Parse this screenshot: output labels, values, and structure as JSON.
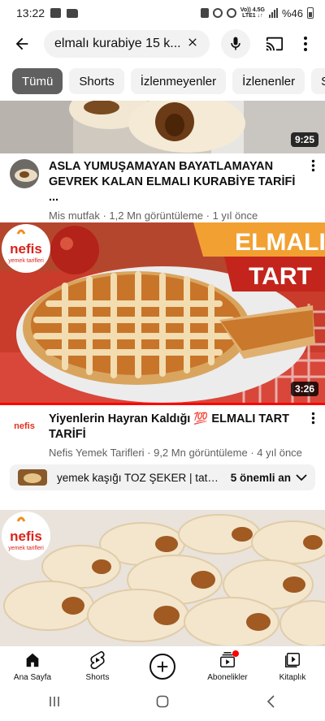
{
  "status_bar": {
    "time": "13:22",
    "network_top": "Vo)) 4.5G",
    "network_bottom": "LTE1 ↓↑",
    "battery": "%46"
  },
  "search": {
    "query": "elmalı kurabiye 15 k...",
    "back_icon": "arrow-left-icon",
    "clear_icon": "close-icon",
    "mic_icon": "microphone-icon",
    "cast_icon": "cast-icon",
    "more_icon": "more-vertical-icon"
  },
  "chips": [
    {
      "label": "Tümü",
      "active": true
    },
    {
      "label": "Shorts",
      "active": false
    },
    {
      "label": "İzlenmeyenler",
      "active": false
    },
    {
      "label": "İzlenenler",
      "active": false
    },
    {
      "label": "Si",
      "active": false
    }
  ],
  "videos": [
    {
      "duration": "9:25",
      "title": "ASLA YUMUŞAMAYAN BAYATLAMAYAN GEVREK KALAN  ELMALI KURABİYE TARİFİ ...",
      "channel": "Mis mutfak",
      "meta": "Mis mutfak · 1,2 Mn görüntüleme · 1 yıl önce"
    },
    {
      "duration": "3:26",
      "thumb_banner_1": "ELMALI",
      "thumb_banner_2": "TART",
      "thumb_logo_1": "nefis",
      "thumb_logo_2": "yemek tarifleri",
      "title": "Yiyenlerin Hayran Kaldığı 💯 ELMALI TART TARİFİ",
      "channel": "Nefis Yemek Tarifleri",
      "meta": "Nefis Yemek Tarifleri · 9,2 Mn görüntüleme · 4 yıl önce",
      "avatar_text": "nefis"
    },
    {
      "thumb_logo_1": "nefis",
      "thumb_logo_2": "yemek tarifleri"
    }
  ],
  "key_moments": {
    "text": "yemek kaşığı TOZ ŞEKER | tatlı...",
    "count": "5 önemli an"
  },
  "bottom_nav": [
    {
      "label": "Ana Sayfa",
      "icon": "home-icon"
    },
    {
      "label": "Shorts",
      "icon": "shorts-icon"
    },
    {
      "label": "",
      "icon": "create-icon"
    },
    {
      "label": "Abonelikler",
      "icon": "subscriptions-icon"
    },
    {
      "label": "Kitaplık",
      "icon": "library-icon"
    }
  ],
  "colors": {
    "accent_red": "#ff0000",
    "chip_active": "#606060",
    "chip_bg": "#f2f2f2",
    "text_secondary": "#606060"
  }
}
